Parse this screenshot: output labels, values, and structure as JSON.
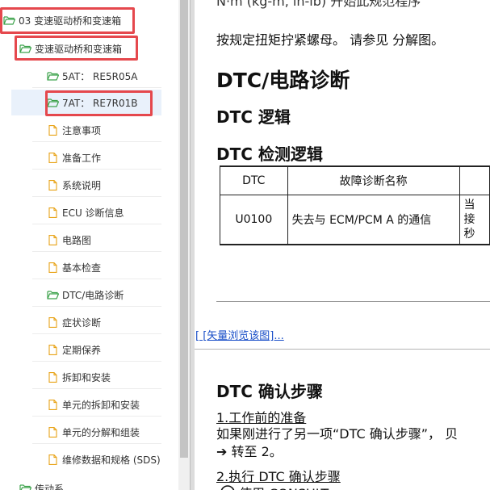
{
  "tree": {
    "items": [
      {
        "label": "03 变速驱动桥和变速箱",
        "icon": "folder-open-icon"
      },
      {
        "label": "变速驱动桥和变速箱",
        "icon": "folder-open-icon"
      },
      {
        "label": "5AT： RE5R05A",
        "icon": "folder-open-icon"
      },
      {
        "label": "7AT： RE7R01B",
        "icon": "folder-open-icon"
      },
      {
        "label": "注意事项",
        "icon": "document-icon"
      },
      {
        "label": "准备工作",
        "icon": "document-icon"
      },
      {
        "label": "系统说明",
        "icon": "document-icon"
      },
      {
        "label": "ECU 诊断信息",
        "icon": "document-icon"
      },
      {
        "label": "电路图",
        "icon": "document-icon"
      },
      {
        "label": "基本检查",
        "icon": "document-icon"
      },
      {
        "label": "DTC/电路诊断",
        "icon": "folder-open-icon"
      },
      {
        "label": "症状诊断",
        "icon": "document-icon"
      },
      {
        "label": "定期保养",
        "icon": "document-icon"
      },
      {
        "label": "拆卸和安装",
        "icon": "document-icon"
      },
      {
        "label": "单元的拆卸和安装",
        "icon": "document-icon"
      },
      {
        "label": "单元的分解和组装",
        "icon": "document-icon"
      },
      {
        "label": "维修数据和规格 (SDS)",
        "icon": "document-icon"
      },
      {
        "label": "传动系",
        "icon": "folder-open-icon"
      }
    ]
  },
  "doc": {
    "top_partial": "N·m (kg-m, in-lb) 开始此规范程序",
    "torque_text": "按规定扭矩拧紧螺母。 请参见 分解图。",
    "title": "DTC/电路诊断",
    "logic_heading": "DTC 逻辑",
    "detect_heading": "DTC 检测逻辑",
    "table": {
      "headers": [
        "DTC",
        "故障诊断名称",
        ""
      ],
      "row": {
        "dtc": "U0100",
        "name": "失去与 ECM/PCM A 的通信",
        "cond": [
          "当",
          "接",
          "秒"
        ]
      }
    },
    "vector_link": "[ [矢量浏览该图]...",
    "confirm_heading": "DTC 确认步骤",
    "step1_title": "1.工作前的准备",
    "step1_body": "如果刚进行了另一项“DTC 确认步骤”， 贝",
    "step1_goto": "➔ 转至 2。",
    "step2_title": "2.执行 DTC 确认步骤",
    "step2_sub": "使用 CONSULT"
  },
  "colors": {
    "highlight": "#e5484d",
    "folder_icon": "#3fa34d",
    "document_icon": "#e8a317",
    "selected_row": "#e9f1fb",
    "link": "#1a4fc8"
  }
}
